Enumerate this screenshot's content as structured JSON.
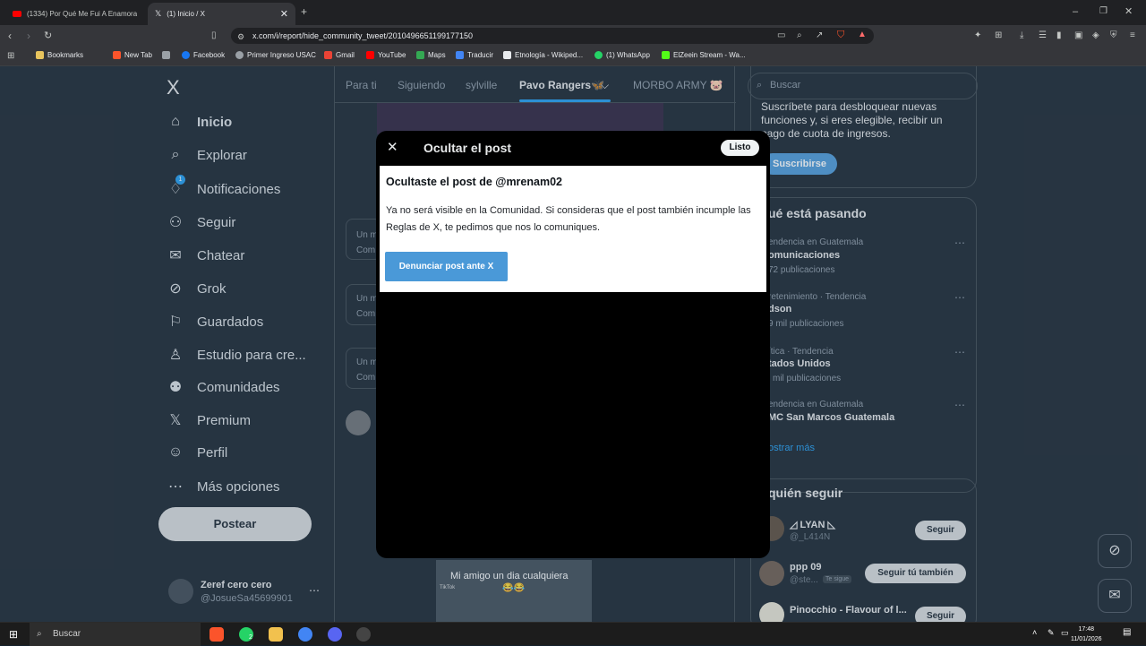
{
  "browser": {
    "tabs": [
      {
        "title": "(1334) Por Qué Me Fui A Enamorar De Ti",
        "active": false
      },
      {
        "title": "(1) Inicio / X",
        "active": true
      }
    ],
    "url": "x.com/i/report/hide_community_tweet/2010496651199177150",
    "bookmarks": [
      "Bookmarks",
      "New Tab",
      "Facebook",
      "Primer Ingreso USAC",
      "Gmail",
      "YouTube",
      "Maps",
      "Traducir",
      "Etnología - Wikiped...",
      "(1) WhatsApp",
      "ElZeein Stream - Wa..."
    ]
  },
  "sidebar": {
    "logo": "X",
    "items": [
      {
        "label": "Inicio",
        "icon": "home-icon"
      },
      {
        "label": "Explorar",
        "icon": "search-icon"
      },
      {
        "label": "Notificaciones",
        "icon": "bell-icon",
        "badge": "1"
      },
      {
        "label": "Seguir",
        "icon": "follow-icon"
      },
      {
        "label": "Chatear",
        "icon": "mail-icon"
      },
      {
        "label": "Grok",
        "icon": "grok-icon"
      },
      {
        "label": "Guardados",
        "icon": "bookmark-icon"
      },
      {
        "label": "Estudio para cre...",
        "icon": "creator-studio-icon"
      },
      {
        "label": "Comunidades",
        "icon": "communities-icon"
      },
      {
        "label": "Premium",
        "icon": "x-premium-icon"
      },
      {
        "label": "Perfil",
        "icon": "profile-icon"
      },
      {
        "label": "Más opciones",
        "icon": "more-icon"
      }
    ],
    "post_button": "Postear",
    "account": {
      "name": "Zeref cero cero",
      "handle": "@JosueSa45699901"
    }
  },
  "feed": {
    "tabs": [
      "Para ti",
      "Siguiendo",
      "sylville",
      "Pavo Rangers🦋",
      "MORBO ARMY 🐷"
    ],
    "snippets": [
      "Un m",
      "Com"
    ],
    "video_caption": "Mi amigo un dia cualquiera",
    "video_emoji": "😂😂",
    "video_watermark": "TikTok"
  },
  "right": {
    "search_placeholder": "Buscar",
    "premium_text": "Suscríbete para desbloquear nuevas funciones y, si eres elegible, recibir un pago de cuota de ingresos.",
    "subscribe": "Suscribirse",
    "trends_title": "ué está pasando",
    "trends": [
      {
        "meta": "endencia en Guatemala",
        "name": "omunicaciones",
        "count": "72 publicaciones"
      },
      {
        "meta": "retenimiento · Tendencia",
        "name": "dson",
        "count": "9 mil publicaciones"
      },
      {
        "meta": "ítica · Tendencia",
        "name": "tados Unidos",
        "count": "l mil publicaciones"
      },
      {
        "meta": "endencia en Guatemala",
        "name": "MC San Marcos Guatemala",
        "count": ""
      }
    ],
    "show_more": "ostrar más",
    "who_title": "quién seguir",
    "who": [
      {
        "name": "◿ LYAN ◺",
        "handle": "@_L414N",
        "button": "Seguir",
        "tag": ""
      },
      {
        "name": "ppp 09",
        "handle": "@ste...",
        "button": "Seguir tú también",
        "tag": "Te sigue"
      },
      {
        "name": "Pinocchio - Flavour of l...",
        "handle": "",
        "button": "Seguir",
        "tag": ""
      }
    ]
  },
  "modal": {
    "title": "Ocultar el post",
    "done": "Listo",
    "heading": "Ocultaste el post de @mrenam02",
    "text": "Ya no será visible en la Comunidad. Si consideras que el post también incumple las Reglas de X, te pedimos que nos lo comuniques.",
    "report_button": "Denunciar post ante X"
  },
  "taskbar": {
    "search": "Buscar",
    "time": "17:48",
    "date": "11/01/2026",
    "whatsapp_badge": "2"
  }
}
